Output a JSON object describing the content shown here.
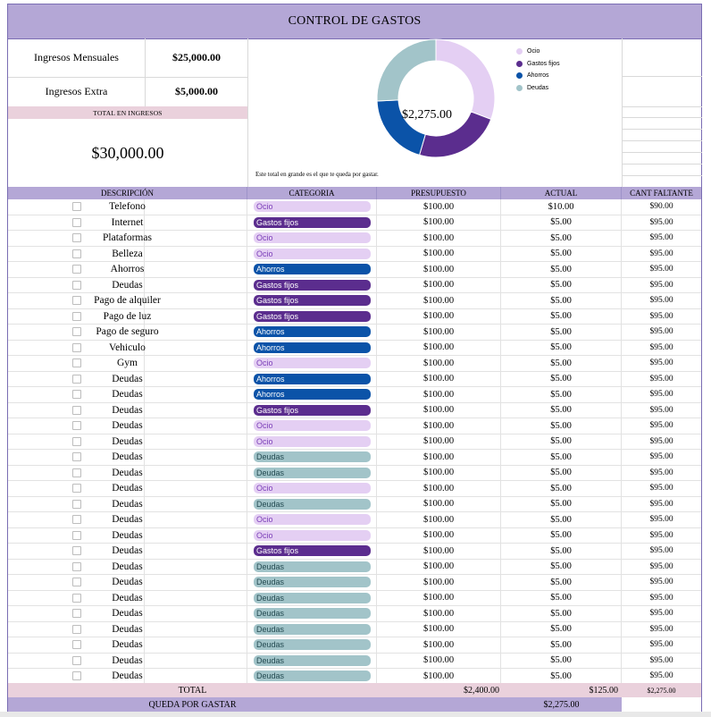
{
  "title": "CONTROL DE GASTOS",
  "income": {
    "rows": [
      {
        "label": "Ingresos Mensuales",
        "value": "$25,000.00"
      },
      {
        "label": "Ingresos Extra",
        "value": "$5,000.00"
      }
    ],
    "total_label": "TOTAL EN INGRESOS",
    "total_value": "$30,000.00"
  },
  "chart_data": {
    "type": "pie",
    "title": "",
    "center_label": "$2,275.00",
    "categories": [
      "Ocio",
      "Gastos fijos",
      "Ahorros",
      "Deudas"
    ],
    "values": [
      700,
      540,
      450,
      585
    ],
    "colors": [
      "#e4cff3",
      "#5b2d8e",
      "#0b53a8",
      "#a2c4c9"
    ],
    "legend_position": "top-right"
  },
  "chart_note": "Este total en grande es el que te queda por gastar.",
  "headers": {
    "descripcion": "DESCRIPCIÓN",
    "categoria": "CATEGORIA",
    "presupuesto": "PRESUPUESTO",
    "actual": "ACTUAL",
    "faltante": "CANT FALTANTE"
  },
  "category_colors": {
    "Ocio": {
      "bg": "#e4cff3",
      "fg": "#7b3fb8"
    },
    "Gastos fijos": {
      "bg": "#5b2d8e",
      "fg": "#ffffff"
    },
    "Ahorros": {
      "bg": "#0b53a8",
      "fg": "#ffffff"
    },
    "Deudas": {
      "bg": "#a2c4c9",
      "fg": "#234a51"
    }
  },
  "rows": [
    {
      "desc": "Telefono",
      "cat": "Ocio",
      "pres": "$100.00",
      "act": "$10.00",
      "falt": "$90.00"
    },
    {
      "desc": "Internet",
      "cat": "Gastos fijos",
      "pres": "$100.00",
      "act": "$5.00",
      "falt": "$95.00"
    },
    {
      "desc": "Plataformas",
      "cat": "Ocio",
      "pres": "$100.00",
      "act": "$5.00",
      "falt": "$95.00"
    },
    {
      "desc": "Belleza",
      "cat": "Ocio",
      "pres": "$100.00",
      "act": "$5.00",
      "falt": "$95.00"
    },
    {
      "desc": "Ahorros",
      "cat": "Ahorros",
      "pres": "$100.00",
      "act": "$5.00",
      "falt": "$95.00"
    },
    {
      "desc": "Deudas",
      "cat": "Gastos fijos",
      "pres": "$100.00",
      "act": "$5.00",
      "falt": "$95.00"
    },
    {
      "desc": "Pago de alquiler",
      "cat": "Gastos fijos",
      "pres": "$100.00",
      "act": "$5.00",
      "falt": "$95.00"
    },
    {
      "desc": "Pago de luz",
      "cat": "Gastos fijos",
      "pres": "$100.00",
      "act": "$5.00",
      "falt": "$95.00"
    },
    {
      "desc": "Pago de seguro",
      "cat": "Ahorros",
      "pres": "$100.00",
      "act": "$5.00",
      "falt": "$95.00"
    },
    {
      "desc": "Vehiculo",
      "cat": "Ahorros",
      "pres": "$100.00",
      "act": "$5.00",
      "falt": "$95.00"
    },
    {
      "desc": "Gym",
      "cat": "Ocio",
      "pres": "$100.00",
      "act": "$5.00",
      "falt": "$95.00"
    },
    {
      "desc": "Deudas",
      "cat": "Ahorros",
      "pres": "$100.00",
      "act": "$5.00",
      "falt": "$95.00"
    },
    {
      "desc": "Deudas",
      "cat": "Ahorros",
      "pres": "$100.00",
      "act": "$5.00",
      "falt": "$95.00"
    },
    {
      "desc": "Deudas",
      "cat": "Gastos fijos",
      "pres": "$100.00",
      "act": "$5.00",
      "falt": "$95.00"
    },
    {
      "desc": "Deudas",
      "cat": "Ocio",
      "pres": "$100.00",
      "act": "$5.00",
      "falt": "$95.00"
    },
    {
      "desc": "Deudas",
      "cat": "Ocio",
      "pres": "$100.00",
      "act": "$5.00",
      "falt": "$95.00"
    },
    {
      "desc": "Deudas",
      "cat": "Deudas",
      "pres": "$100.00",
      "act": "$5.00",
      "falt": "$95.00"
    },
    {
      "desc": "Deudas",
      "cat": "Deudas",
      "pres": "$100.00",
      "act": "$5.00",
      "falt": "$95.00"
    },
    {
      "desc": "Deudas",
      "cat": "Ocio",
      "pres": "$100.00",
      "act": "$5.00",
      "falt": "$95.00"
    },
    {
      "desc": "Deudas",
      "cat": "Deudas",
      "pres": "$100.00",
      "act": "$5.00",
      "falt": "$95.00"
    },
    {
      "desc": "Deudas",
      "cat": "Ocio",
      "pres": "$100.00",
      "act": "$5.00",
      "falt": "$95.00"
    },
    {
      "desc": "Deudas",
      "cat": "Ocio",
      "pres": "$100.00",
      "act": "$5.00",
      "falt": "$95.00"
    },
    {
      "desc": "Deudas",
      "cat": "Gastos fijos",
      "pres": "$100.00",
      "act": "$5.00",
      "falt": "$95.00"
    },
    {
      "desc": "Deudas",
      "cat": "Deudas",
      "pres": "$100.00",
      "act": "$5.00",
      "falt": "$95.00"
    },
    {
      "desc": "Deudas",
      "cat": "Deudas",
      "pres": "$100.00",
      "act": "$5.00",
      "falt": "$95.00"
    },
    {
      "desc": "Deudas",
      "cat": "Deudas",
      "pres": "$100.00",
      "act": "$5.00",
      "falt": "$95.00"
    },
    {
      "desc": "Deudas",
      "cat": "Deudas",
      "pres": "$100.00",
      "act": "$5.00",
      "falt": "$95.00"
    },
    {
      "desc": "Deudas",
      "cat": "Deudas",
      "pres": "$100.00",
      "act": "$5.00",
      "falt": "$95.00"
    },
    {
      "desc": "Deudas",
      "cat": "Deudas",
      "pres": "$100.00",
      "act": "$5.00",
      "falt": "$95.00"
    },
    {
      "desc": "Deudas",
      "cat": "Deudas",
      "pres": "$100.00",
      "act": "$5.00",
      "falt": "$95.00"
    },
    {
      "desc": "Deudas",
      "cat": "Deudas",
      "pres": "$100.00",
      "act": "$5.00",
      "falt": "$95.00"
    }
  ],
  "totals": {
    "label": "TOTAL",
    "presupuesto": "$2,400.00",
    "actual": "$125.00",
    "faltante": "$2,275.00"
  },
  "queda": {
    "label": "QUEDA POR GASTAR",
    "value": "$2,275.00"
  }
}
